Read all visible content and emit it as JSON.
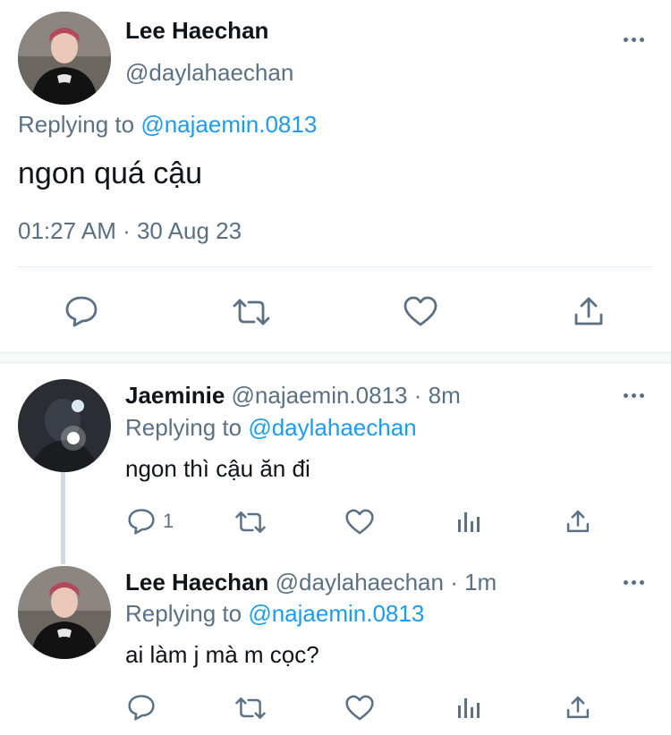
{
  "main_tweet": {
    "name": "Lee Haechan",
    "handle": "@daylahaechan",
    "replying_prefix": "Replying to",
    "replying_to": "@najaemin.0813",
    "text": "ngon quá cậu",
    "timestamp": "01:27 AM · 30 Aug 23",
    "avatar_icon": "avatar-haechan",
    "actions": [
      "reply-icon",
      "retweet-icon",
      "like-icon",
      "share-icon"
    ]
  },
  "replies": [
    {
      "name": "Jaeminie",
      "handle": "@najaemin.0813",
      "time": "· 8m",
      "replying_prefix": "Replying to",
      "replying_to": "@daylahaechan",
      "text": "ngon thì cậu ăn đi",
      "reply_count": "1",
      "avatar_icon": "avatar-jaemin"
    },
    {
      "name": "Lee Haechan",
      "handle": "@daylahaechan",
      "time": "· 1m",
      "replying_prefix": "Replying to",
      "replying_to": "@najaemin.0813",
      "text": "ai làm j mà m cọc?",
      "reply_count": "",
      "avatar_icon": "avatar-haechan"
    }
  ],
  "colors": {
    "accent": "#1d9bf0",
    "muted": "#5b7083",
    "text": "#0f1419"
  }
}
